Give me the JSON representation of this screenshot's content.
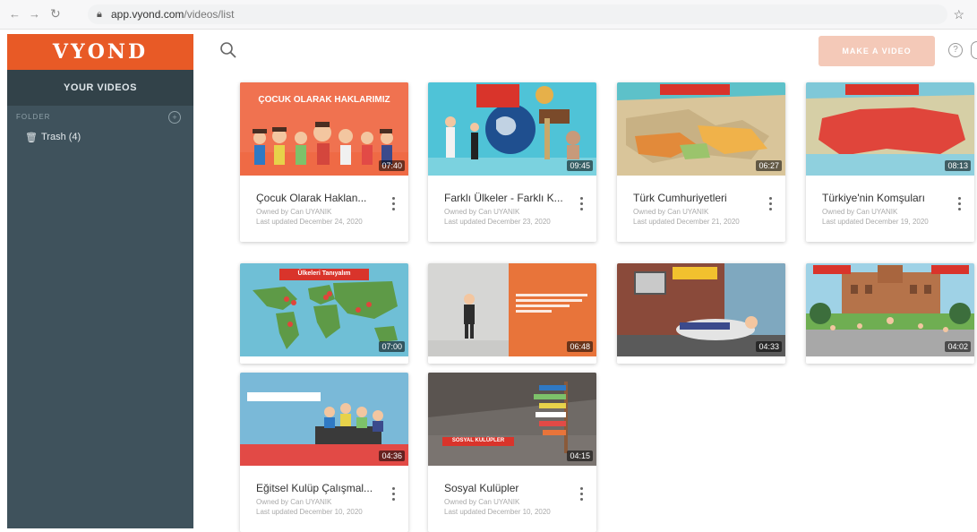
{
  "browser": {
    "url_domain": "app.vyond.com",
    "url_path": "/videos/list"
  },
  "sidebar": {
    "logo": "VYOND",
    "your_videos": "YOUR VIDEOS",
    "folder_label": "FOLDER",
    "items": [
      {
        "label": "Trash (4)"
      }
    ]
  },
  "header": {
    "make_video_label": "MAKE A VIDEO"
  },
  "videos": [
    {
      "title": "Çocuk Olarak Haklan...",
      "owner": "Owned by Can UYANIK",
      "updated": "Last updated December 24, 2020",
      "duration": "07:40",
      "thumb_text": "ÇOCUK OLARAK HAKLARIMIZ"
    },
    {
      "title": "Farklı Ülkeler - Farklı K...",
      "owner": "Owned by Can UYANIK",
      "updated": "Last updated December 23, 2020",
      "duration": "09:45",
      "thumb_text": ""
    },
    {
      "title": "Türk Cumhuriyetleri",
      "owner": "Owned by Can UYANIK",
      "updated": "Last updated December 21, 2020",
      "duration": "06:27",
      "thumb_text": ""
    },
    {
      "title": "Türkiye'nin Komşuları",
      "owner": "Owned by Can UYANIK",
      "updated": "Last updated December 19, 2020",
      "duration": "08:13",
      "thumb_text": ""
    },
    {
      "title": "",
      "owner": "",
      "updated": "",
      "duration": "07:00",
      "thumb_text": "Ülkeleri Tanıyalım"
    },
    {
      "title": "",
      "owner": "",
      "updated": "",
      "duration": "06:48",
      "thumb_text": ""
    },
    {
      "title": "",
      "owner": "",
      "updated": "",
      "duration": "04:33",
      "thumb_text": ""
    },
    {
      "title": "",
      "owner": "",
      "updated": "",
      "duration": "04:02",
      "thumb_text": ""
    },
    {
      "title": "Eğitsel Kulüp Çalışmal...",
      "owner": "Owned by Can UYANIK",
      "updated": "Last updated December 10, 2020",
      "duration": "04:36",
      "thumb_text": ""
    },
    {
      "title": "Sosyal Kulüpler",
      "owner": "Owned by Can UYANIK",
      "updated": "Last updated December 10, 2020",
      "duration": "04:15",
      "thumb_text": "SOSYAL KULÜPLER"
    }
  ]
}
